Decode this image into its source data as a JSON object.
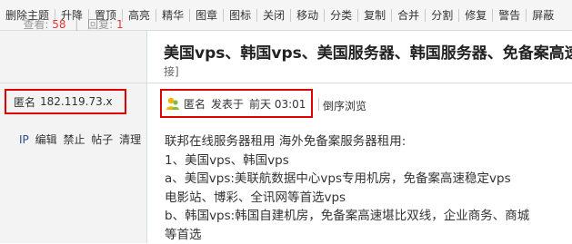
{
  "toolbar": {
    "items": [
      "删除主题",
      "升降",
      "置顶",
      "高亮",
      "精华",
      "图章",
      "图标",
      "关闭",
      "移动",
      "分类",
      "复制",
      "合并",
      "分割",
      "修复",
      "警告",
      "屏蔽"
    ]
  },
  "stats": {
    "views_label": "查看:",
    "views": "58",
    "replies_label": "回复:",
    "replies": "1"
  },
  "author": {
    "name": "匿名",
    "ip": "182.119.73.x"
  },
  "admin_links": {
    "ip": "IP",
    "edit": "编辑",
    "ban": "禁止",
    "posts": "帖子",
    "clear": "清理"
  },
  "post": {
    "title": "美国vps、韩国vps、美国服务器、韩国服务器、免备案高速服务器[",
    "title_tail": "接]",
    "author": "匿名",
    "posted_label": "发表于",
    "time": "前天 03:01",
    "reverse_view": "倒序浏览",
    "lines": [
      "联邦在线服务器租用  海外免备案服务器租用:",
      "1、美国vps、韩国vps",
      "a、美国vps:美联航数据中心vps专用机房，免备案高速稳定vps",
      "电影站、博彩、全讯网等首选vps",
      "b、韩国vps:韩国自建机房，免备案高速堪比双线，企业商务、商城",
      "等首选"
    ]
  }
}
